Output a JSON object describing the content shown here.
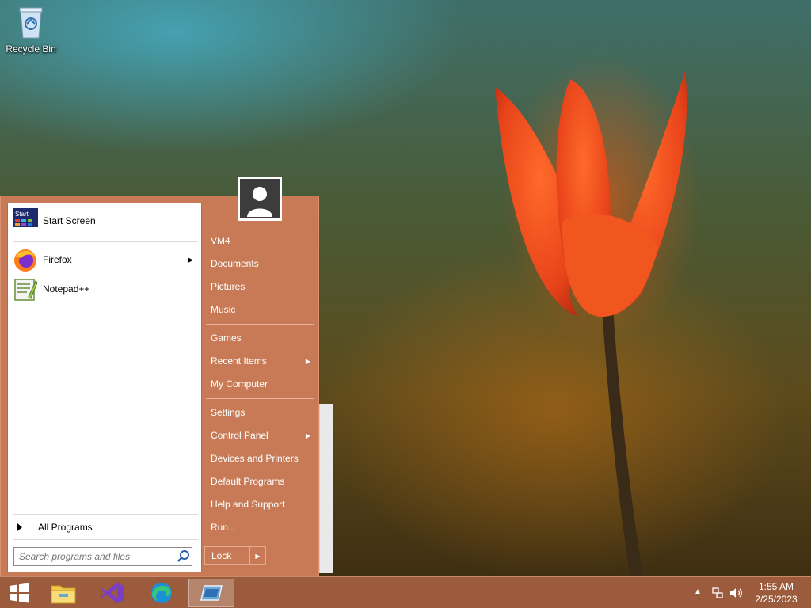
{
  "desktop": {
    "icons": [
      {
        "label": "Recycle Bin",
        "icon": "recycle-bin-icon"
      }
    ]
  },
  "start_menu": {
    "pinned": [
      {
        "label": "Start Screen",
        "icon": "start-screen-icon",
        "icon_text": "Start"
      },
      {
        "label": "Firefox",
        "icon": "firefox-icon",
        "has_submenu": true
      },
      {
        "label": "Notepad++",
        "icon": "notepad-plus-plus-icon"
      }
    ],
    "all_programs_label": "All Programs",
    "search_placeholder": "Search programs and files",
    "right_items": [
      {
        "label": "VM4"
      },
      {
        "label": "Documents"
      },
      {
        "label": "Pictures"
      },
      {
        "label": "Music"
      },
      {
        "label": "Games"
      },
      {
        "label": "Recent Items",
        "has_submenu": true
      },
      {
        "label": "My Computer"
      },
      {
        "label": "Settings"
      },
      {
        "label": "Control Panel",
        "has_submenu": true
      },
      {
        "label": "Devices and Printers"
      },
      {
        "label": "Default Programs"
      },
      {
        "label": "Help and Support"
      },
      {
        "label": "Run..."
      }
    ],
    "lock_label": "Lock"
  },
  "taskbar": {
    "buttons": [
      {
        "icon": "windows-start-icon"
      },
      {
        "icon": "file-explorer-icon"
      },
      {
        "icon": "visual-studio-icon"
      },
      {
        "icon": "edge-icon"
      },
      {
        "icon": "app-window-icon",
        "active": true
      }
    ],
    "clock": {
      "time": "1:55 AM",
      "date": "2/25/2023"
    }
  },
  "colors": {
    "menu_accent": "#c77a55",
    "taskbar": "#a55f41"
  }
}
